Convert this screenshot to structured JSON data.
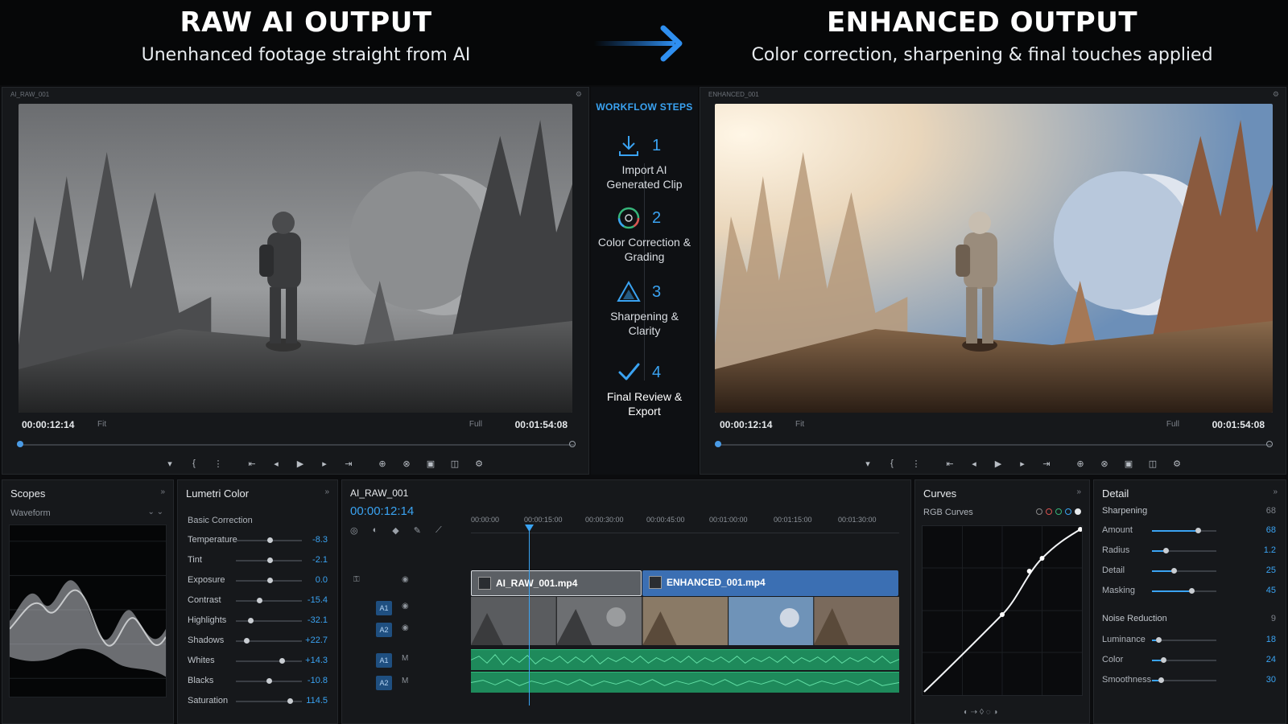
{
  "header": {
    "left_title": "RAW AI OUTPUT",
    "left_subtitle": "Unenhanced footage straight from AI",
    "right_title": "ENHANCED OUTPUT",
    "right_subtitle": "Color correction, sharpening & final touches applied"
  },
  "monitor_left": {
    "label": "AI_RAW_001",
    "timecode_in": "00:00:12:14",
    "fit": "Fit",
    "resolution": "Full",
    "timecode_out": "00:01:54:08"
  },
  "monitor_right": {
    "label": "ENHANCED_001",
    "timecode_in": "00:00:12:14",
    "fit": "Fit",
    "resolution": "Full",
    "timecode_out": "00:01:54:08"
  },
  "workflow": {
    "title": "WORKFLOW STEPS",
    "steps": [
      {
        "num": "1",
        "label": "Import AI Generated Clip"
      },
      {
        "num": "2",
        "label": "Color Correction & Grading"
      },
      {
        "num": "3",
        "label": "Sharpening & Clarity"
      },
      {
        "num": "4",
        "label": "Final Review & Export"
      }
    ]
  },
  "scopes": {
    "title": "Scopes",
    "mode": "Waveform"
  },
  "lumetri": {
    "title": "Lumetri Color",
    "section": "Basic Correction",
    "rows": [
      {
        "name": "Temperature",
        "value": "-8.3"
      },
      {
        "name": "Tint",
        "value": "-2.1"
      },
      {
        "name": "Exposure",
        "value": "0.0"
      },
      {
        "name": "Contrast",
        "value": "-15.4"
      },
      {
        "name": "Highlights",
        "value": "-32.1"
      },
      {
        "name": "Shadows",
        "value": "+22.7"
      },
      {
        "name": "Whites",
        "value": "+14.3"
      },
      {
        "name": "Blacks",
        "value": "-10.8"
      },
      {
        "name": "Saturation",
        "value": "114.5"
      }
    ]
  },
  "timeline": {
    "sequence": "AI_RAW_001",
    "timecode": "00:00:12:14",
    "ticks": [
      "00:00:00",
      "00:00:15:00",
      "00:00:30:00",
      "00:00:45:00",
      "00:01:00:00",
      "00:01:15:00",
      "00:01:30:00"
    ],
    "tracks": {
      "v1": "A1",
      "v2": "A2",
      "a1": "A1",
      "a2": "A2"
    },
    "clip_raw": "AI_RAW_001.mp4",
    "clip_enhanced": "ENHANCED_001.mp4"
  },
  "curves": {
    "title": "Curves",
    "mode": "RGB Curves"
  },
  "detail": {
    "title": "Detail",
    "sharpening_title": "Sharpening",
    "sharpening_toggle": "68",
    "sharpening": [
      {
        "name": "Amount",
        "value": "68"
      },
      {
        "name": "Radius",
        "value": "1.2"
      },
      {
        "name": "Detail",
        "value": "25"
      },
      {
        "name": "Masking",
        "value": "45"
      }
    ],
    "noise_title": "Noise Reduction",
    "noise_toggle": "9",
    "noise": [
      {
        "name": "Luminance",
        "value": "18"
      },
      {
        "name": "Color",
        "value": "24"
      },
      {
        "name": "Smoothness",
        "value": "30"
      }
    ]
  },
  "colors": {
    "accent": "#3aa3f2",
    "clip_enhanced": "#3b6fb3",
    "audio": "#1e8a5b"
  }
}
